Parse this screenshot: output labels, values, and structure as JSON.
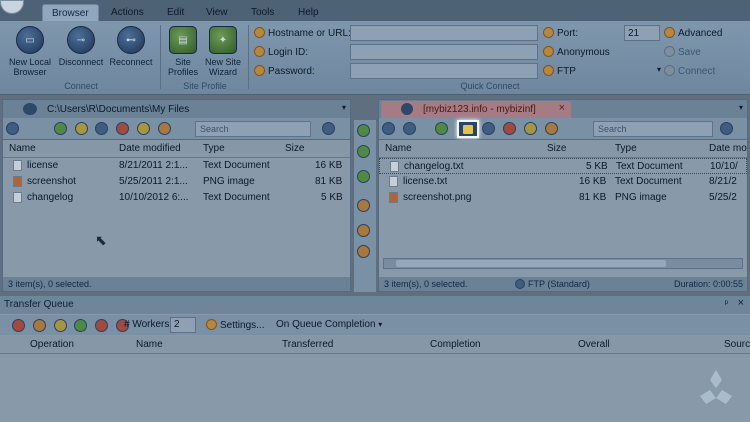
{
  "ribbon": {
    "tabs": [
      "Browser",
      "Actions",
      "Edit",
      "View",
      "Tools",
      "Help"
    ],
    "connect_group": {
      "label": "Connect",
      "buttons": [
        "New Local Browser",
        "Disconnect",
        "Reconnect"
      ]
    },
    "site_profile_group": {
      "label": "Site Profile",
      "buttons": [
        "Site Profiles",
        "New Site Wizard"
      ]
    },
    "quick_connect": {
      "label": "Quick Connect",
      "hostname_label": "Hostname or URL:",
      "login_label": "Login ID:",
      "password_label": "Password:",
      "port_label": "Port:",
      "port_value": "21",
      "anonymous_label": "Anonymous",
      "protocol_value": "FTP",
      "advanced_label": "Advanced",
      "save_label": "Save",
      "connect_label": "Connect"
    }
  },
  "left_pane": {
    "path": "C:\\Users\\R\\Documents\\My Files",
    "search_placeholder": "Search",
    "columns": [
      "Name",
      "Date modified",
      "Type",
      "Size"
    ],
    "rows": [
      {
        "name": "license",
        "date": "8/21/2011 2:1...",
        "type": "Text Document",
        "size": "16 KB"
      },
      {
        "name": "screenshot",
        "date": "5/25/2011 2:1...",
        "type": "PNG image",
        "size": "81 KB"
      },
      {
        "name": "changelog",
        "date": "10/10/2012 6:...",
        "type": "Text Document",
        "size": "5 KB"
      }
    ],
    "status": "3 item(s), 0 selected."
  },
  "right_pane": {
    "tab_title": "[mybiz123.info - mybizinf]",
    "search_placeholder": "Search",
    "columns": [
      "Name",
      "Size",
      "Type",
      "Date mo"
    ],
    "rows": [
      {
        "name": "changelog.txt",
        "size": "5 KB",
        "type": "Text Document",
        "date": "10/10/"
      },
      {
        "name": "license.txt",
        "size": "16 KB",
        "type": "Text Document",
        "date": "8/21/2"
      },
      {
        "name": "screenshot.png",
        "size": "81 KB",
        "type": "PNG image",
        "date": "5/25/2"
      }
    ],
    "status": "3 item(s), 0 selected.",
    "protocol_status": "FTP (Standard)",
    "duration": "Duration: 0:00:55"
  },
  "transfer_queue": {
    "title": "Transfer Queue",
    "workers_label": "# Workers",
    "workers_value": "2",
    "settings_label": "Settings...",
    "on_completion_label": "On Queue Completion",
    "columns": [
      "Operation",
      "Name",
      "Transferred",
      "Completion",
      "Overall",
      "Sourc"
    ]
  }
}
